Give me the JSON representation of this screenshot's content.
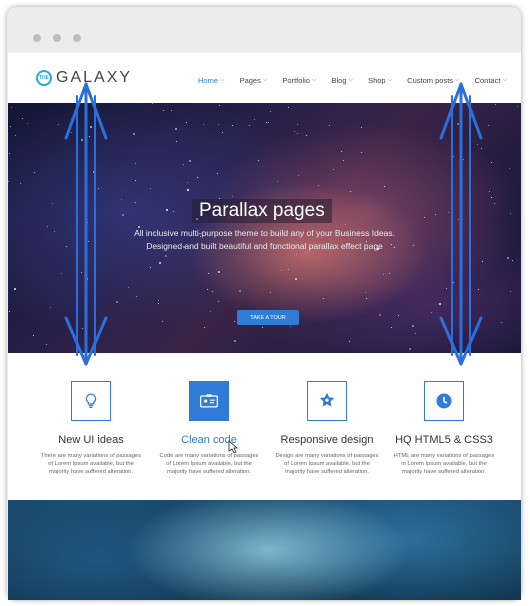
{
  "brand": {
    "badge": "THE",
    "name": "GALAXY"
  },
  "nav": [
    {
      "label": "Home",
      "active": true
    },
    {
      "label": "Pages",
      "active": false
    },
    {
      "label": "Portfolio",
      "active": false
    },
    {
      "label": "Blog",
      "active": false
    },
    {
      "label": "Shop",
      "active": false
    },
    {
      "label": "Custom posts",
      "active": false
    },
    {
      "label": "Contact",
      "active": false
    }
  ],
  "hero": {
    "title": "Parallax pages",
    "line1": "All inclusive multi-purpose theme to build any of your Business Ideas.",
    "line2": "Designed and built beautiful and functional parallax effect page",
    "button": "TAKE A TOUR"
  },
  "features": [
    {
      "title": "New UI ideas",
      "text": "There are many variations of passages of Lorem Ipsum available, but the majority have suffered alteration.",
      "icon": "lightbulb-icon"
    },
    {
      "title": "Clean code",
      "text": "Code are many variations of passages of Lorem Ipsum available, but the majority have suffered alteration.",
      "icon": "id-card-icon"
    },
    {
      "title": "Responsive design",
      "text": "Design are many variations of passages of Lorem Ipsum available, but the majority have suffered alteration.",
      "icon": "star-shield-icon"
    },
    {
      "title": "HQ HTML5 & CSS3",
      "text": "HTML are many variations of passages in Lorem Ipsum available, but the majority have suffered alteration.",
      "icon": "clock-icon"
    }
  ],
  "colors": {
    "accent": "#2e7cd6",
    "annotation": "#2c6fdc",
    "logo": "#29a8e0"
  }
}
